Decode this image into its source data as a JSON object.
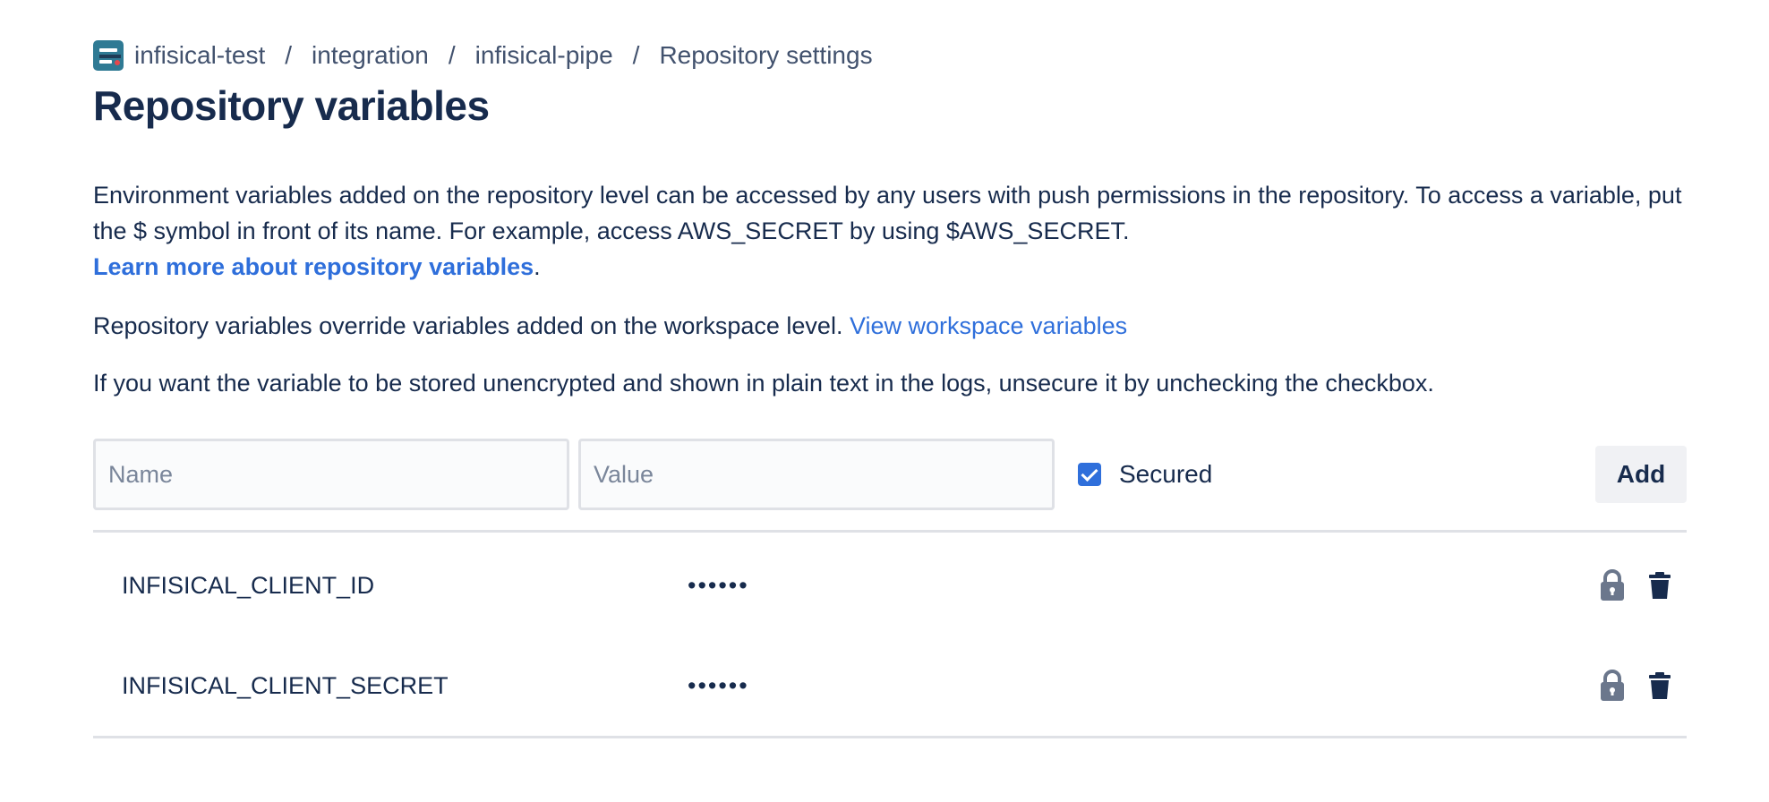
{
  "breadcrumb": {
    "workspace": "infisical-test",
    "project": "integration",
    "repository": "infisical-pipe",
    "current": "Repository settings",
    "separator": "/"
  },
  "page": {
    "title": "Repository variables"
  },
  "description": {
    "intro": "Environment variables added on the repository level can be accessed by any users with push permissions in the repository. To access a variable, put the $ symbol in front of its name. For example, access AWS_SECRET by using $AWS_SECRET.",
    "learn_more_link": "Learn more about repository variables",
    "learn_more_suffix": ".",
    "override_text": "Repository variables override variables added on the workspace level.",
    "workspace_link": "View workspace variables",
    "unsecure_text": "If you want the variable to be stored unencrypted and shown in plain text in the logs, unsecure it by unchecking the checkbox."
  },
  "form": {
    "name_placeholder": "Name",
    "value_placeholder": "Value",
    "secured_label": "Secured",
    "secured_checked": true,
    "add_label": "Add"
  },
  "variables": [
    {
      "name": "INFISICAL_CLIENT_ID",
      "value": "••••••",
      "secured": true
    },
    {
      "name": "INFISICAL_CLIENT_SECRET",
      "value": "••••••",
      "secured": true
    }
  ],
  "colors": {
    "link": "#2f6fdb",
    "text": "#172b4d",
    "muted": "#42526e",
    "icon": "#6b778c",
    "checkbox": "#2f6fdb"
  }
}
